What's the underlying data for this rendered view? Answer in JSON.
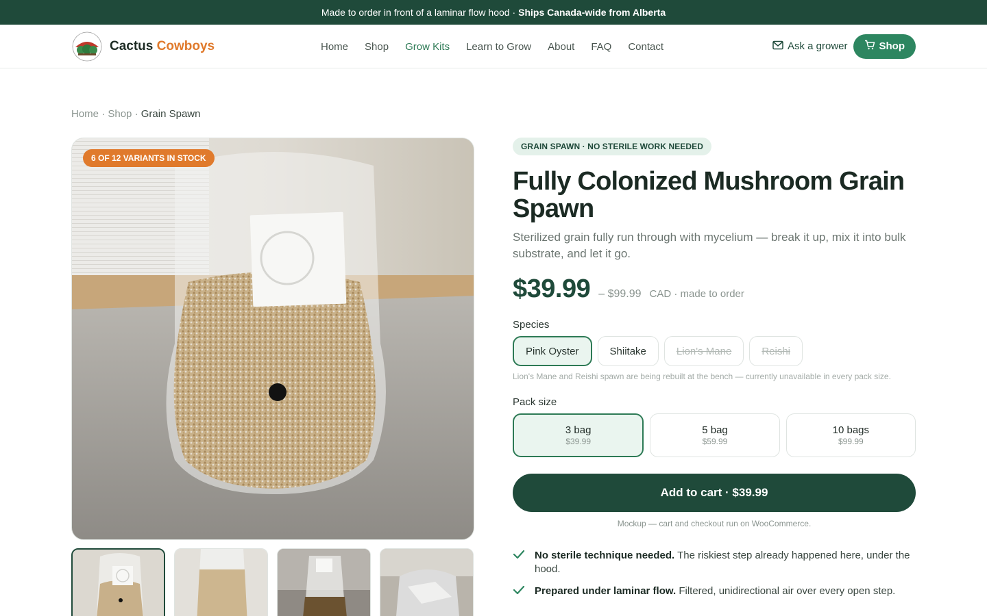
{
  "announcement": {
    "text": "Made to order in front of a laminar flow hood ·",
    "strong": "Ships Canada-wide from Alberta"
  },
  "brand": {
    "name": "Cactus",
    "accent": "Cowboys"
  },
  "nav": {
    "items": [
      {
        "label": "Home"
      },
      {
        "label": "Shop"
      },
      {
        "label": "Grow Kits"
      },
      {
        "label": "Learn to Grow"
      },
      {
        "label": "About"
      },
      {
        "label": "FAQ"
      },
      {
        "label": "Contact"
      }
    ],
    "active_index": 2,
    "ask_label": "Ask a grower",
    "shop_label": "Shop"
  },
  "breadcrumb": {
    "home": "Home",
    "shop": "Shop",
    "current": "Grain Spawn",
    "sep": "·"
  },
  "gallery": {
    "badge": "6 OF 12 VARIANTS IN STOCK",
    "thumb_count": 4,
    "selected_index": 0
  },
  "product": {
    "tag": "GRAIN SPAWN · NO STERILE WORK NEEDED",
    "title": "Fully Colonized Mushroom Grain Spawn",
    "subtitle": "Sterilized grain fully run through with mycelium — break it up, mix it into bulk substrate, and let it go.",
    "price": "$39.99",
    "price_max": "– $99.99",
    "price_note": "CAD · made to order",
    "species_label": "Species",
    "species": [
      {
        "label": "Pink Oyster",
        "selected": true,
        "available": true
      },
      {
        "label": "Shiitake",
        "selected": false,
        "available": true
      },
      {
        "label": "Lion's Mane",
        "selected": false,
        "available": false
      },
      {
        "label": "Reishi",
        "selected": false,
        "available": false
      }
    ],
    "species_hint": "Lion's Mane and Reishi spawn are being rebuilt at the bench — currently unavailable in every pack size.",
    "pack_label": "Pack size",
    "packs": [
      {
        "name": "3 bag",
        "price": "$39.99",
        "selected": true
      },
      {
        "name": "5 bag",
        "price": "$59.99",
        "selected": false
      },
      {
        "name": "10 bags",
        "price": "$99.99",
        "selected": false
      }
    ],
    "cart_label": "Add to cart · $39.99",
    "cart_note": "Mockup — cart and checkout run on WooCommerce.",
    "features": [
      {
        "bold": "No sterile technique needed.",
        "text": "The riskiest step already happened here, under the hood."
      },
      {
        "bold": "Prepared under laminar flow.",
        "text": "Filtered, unidirectional air over every open step."
      }
    ]
  },
  "colors": {
    "dark_green": "#1f4a3a",
    "accent_green": "#2d8660",
    "orange": "#e07a2c"
  }
}
